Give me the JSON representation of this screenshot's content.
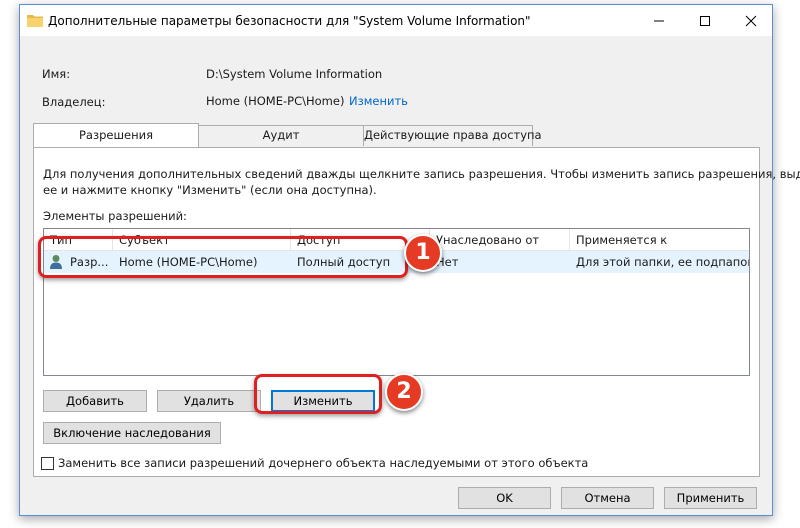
{
  "window": {
    "title": "Дополнительные параметры безопасности  для \"System Volume Information\"",
    "icon": "folder-icon",
    "controls": [
      "minimize-icon",
      "maximize-icon",
      "close-icon"
    ]
  },
  "info": {
    "name_label": "Имя:",
    "name_value": "D:\\System Volume Information",
    "owner_label": "Владелец:",
    "owner_value": "Home (HOME-PC\\Home)",
    "owner_change_link": "Изменить"
  },
  "tabs": [
    {
      "label": "Разрешения",
      "active": true
    },
    {
      "label": "Аудит",
      "active": false
    },
    {
      "label": "Действующие права доступа",
      "active": false
    }
  ],
  "panel": {
    "description_line1": "Для получения дополнительных сведений дважды щелкните запись разрешения. Чтобы изменить запись разрешения, выделите",
    "description_line2": "ее и нажмите кнопку \"Изменить\" (если она доступна).",
    "list_label": "Элементы разрешений:"
  },
  "table": {
    "columns": [
      "Тип",
      "Субъект",
      "Доступ",
      "Унаследовано от",
      "Применяется к"
    ],
    "rows": [
      {
        "icon": "user-icon",
        "type": "Разр...",
        "principal": "Home (HOME-PC\\Home)",
        "access": "Полный доступ",
        "inherited": "Нет",
        "applies_to": "Для этой папки, ее подпапок ..."
      }
    ]
  },
  "buttons": {
    "add": "Добавить",
    "remove": "Удалить",
    "edit": "Изменить",
    "enable_inheritance": "Включение наследования",
    "ok": "OK",
    "cancel": "Отмена",
    "apply": "Применить"
  },
  "replace_checkbox": {
    "label": "Заменить все записи разрешений дочернего объекта наследуемыми от этого объекта",
    "checked": false
  },
  "annotations": {
    "badge1": "1",
    "badge2": "2",
    "highlight_color": "#e02020"
  },
  "colors": {
    "accent": "#0078d7",
    "link": "#0066cc",
    "selection": "#e5f3ff"
  }
}
